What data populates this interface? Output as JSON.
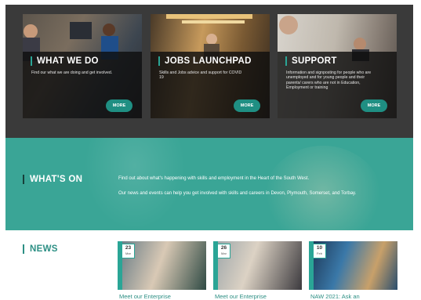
{
  "cards": [
    {
      "title": "WHAT WE DO",
      "desc": "Find our what we are doing and get involved.",
      "more": "MORE"
    },
    {
      "title": "JOBS LAUNCHPAD",
      "desc": "Skills and Jobs advice and support for COVID 19",
      "more": "MORE"
    },
    {
      "title": "SUPPORT",
      "desc": "Information and signposting for people who are unemployed and for young people and their parents/ carers who are not in Education, Employment or training",
      "more": "MORE"
    }
  ],
  "whats_on": {
    "heading": "WHAT'S ON",
    "line1": "Find out about what's happening with skills and employment in the Heart of the South West.",
    "line2": "Our news and events can help you get involved with skills and careers in Devon, Plymouth, Somerset, and Torbay."
  },
  "news": {
    "heading": "NEWS",
    "items": [
      {
        "day": "23",
        "month": "Mar",
        "title": "Meet our Enterprise"
      },
      {
        "day": "26",
        "month": "Mar",
        "title": "Meet our Enterprise"
      },
      {
        "day": "10",
        "month": "Feb",
        "title": "NAW 2021: Ask an"
      }
    ]
  },
  "colors": {
    "accent": "#3aa596",
    "dark": "#3a3a3a",
    "button": "#1f8f83"
  }
}
